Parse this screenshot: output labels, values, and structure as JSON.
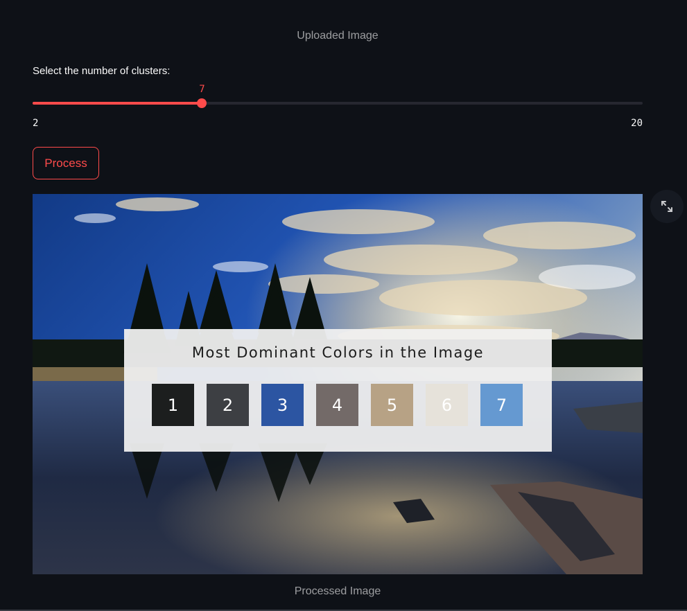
{
  "uploaded_caption": "Uploaded Image",
  "processed_caption": "Processed Image",
  "slider": {
    "label": "Select the number of clusters:",
    "value": 7,
    "value_text": "7",
    "min": 2,
    "max": 20,
    "min_text": "2",
    "max_text": "20",
    "accent": "#ff4b4b"
  },
  "process_button": {
    "label": "Process"
  },
  "fullscreen_button": {
    "icon": "expand-icon"
  },
  "overlay": {
    "title": "Most Dominant Colors in the Image",
    "swatches": [
      {
        "label": "1",
        "color": "#1c1e1e"
      },
      {
        "label": "2",
        "color": "#3d3f43"
      },
      {
        "label": "3",
        "color": "#2c55a2"
      },
      {
        "label": "4",
        "color": "#736a68"
      },
      {
        "label": "5",
        "color": "#b7a285"
      },
      {
        "label": "6",
        "color": "#e6e2da"
      },
      {
        "label": "7",
        "color": "#6599d1"
      }
    ]
  }
}
